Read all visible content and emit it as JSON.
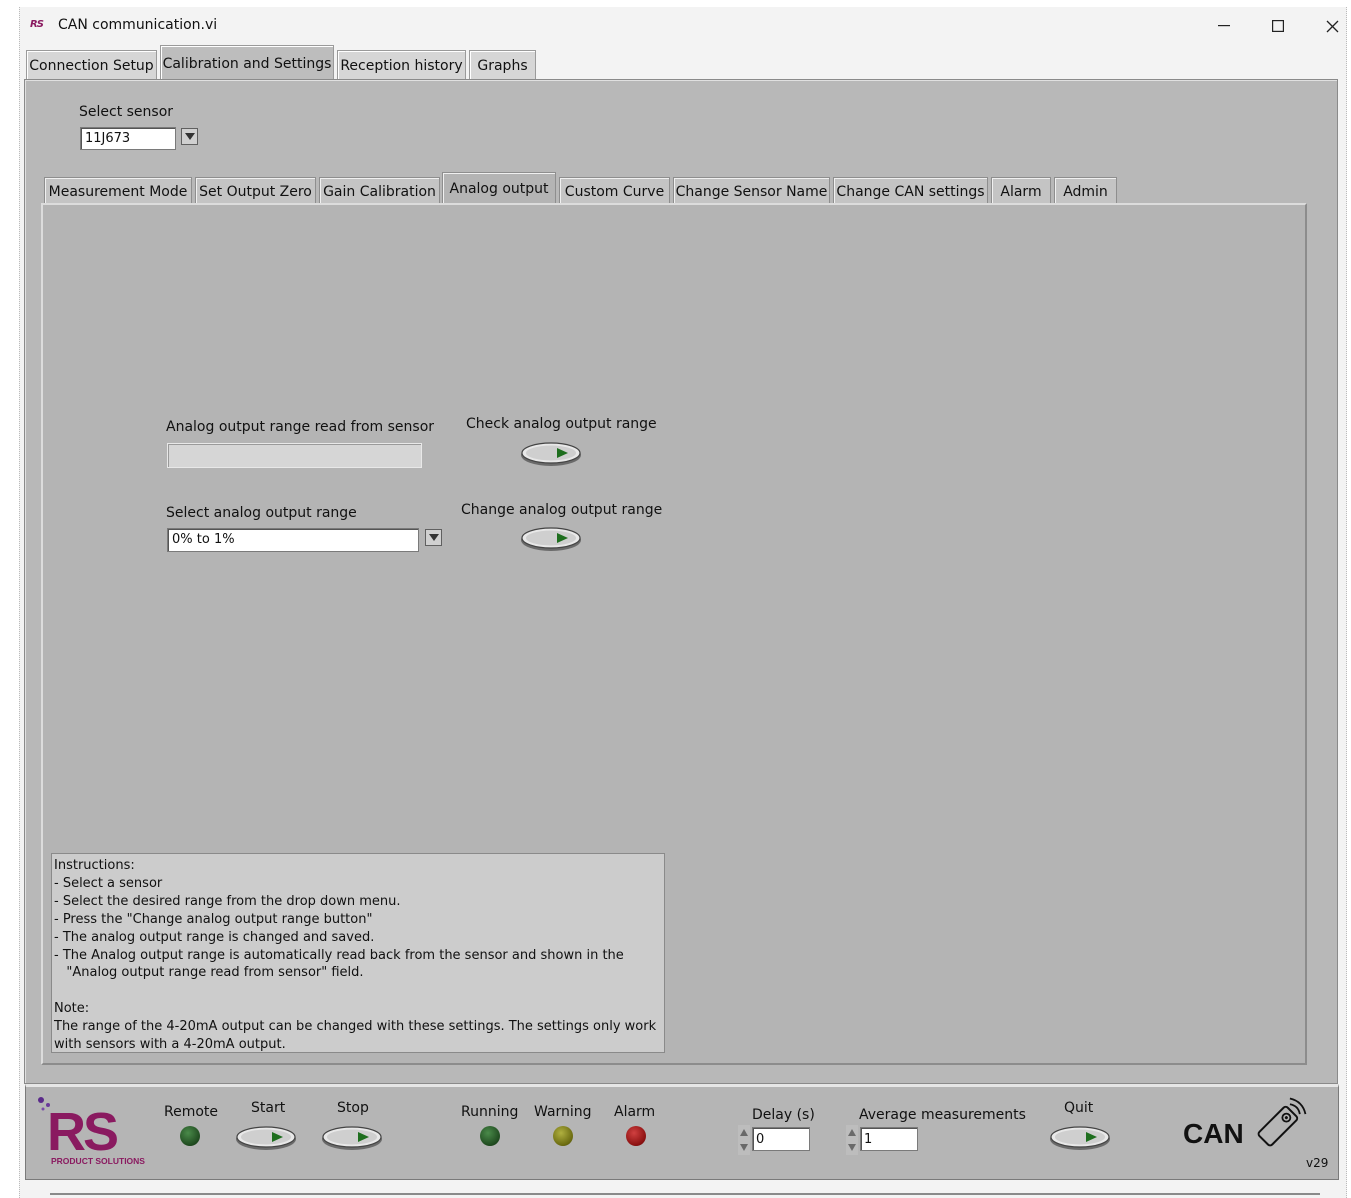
{
  "window": {
    "title": "CAN communication.vi",
    "logo_text": "RS",
    "minimize": "—",
    "maximize": "☐",
    "close": "✕"
  },
  "main_tabs": [
    {
      "label": "Connection Setup",
      "active": false
    },
    {
      "label": "Calibration and Settings",
      "active": true
    },
    {
      "label": "Reception history",
      "active": false
    },
    {
      "label": "Graphs",
      "active": false
    }
  ],
  "sensor": {
    "label": "Select sensor",
    "value": "11J673"
  },
  "sub_tabs": [
    {
      "label": "Measurement Mode",
      "active": false
    },
    {
      "label": "Set Output Zero",
      "active": false
    },
    {
      "label": "Gain Calibration",
      "active": false
    },
    {
      "label": "Analog output",
      "active": true
    },
    {
      "label": "Custom Curve",
      "active": false
    },
    {
      "label": "Change Sensor Name",
      "active": false
    },
    {
      "label": "Change CAN settings",
      "active": false
    },
    {
      "label": "Alarm",
      "active": false
    },
    {
      "label": "Admin",
      "active": false
    }
  ],
  "analog": {
    "read_label": "Analog output range read from sensor",
    "read_value": "",
    "check_label": "Check analog output range",
    "select_label": "Select analog output range",
    "select_value": "0% to 1%",
    "change_label": "Change analog output range"
  },
  "instructions": {
    "text": "Instructions:\n- Select a sensor\n- Select the desired range from the drop down menu.\n- Press the \"Change analog output range button\"\n- The analog output range is changed and saved.\n- The Analog output range is automatically read back from the sensor and shown in the\n   \"Analog output range read from sensor\" field.\n\nNote:\nThe range of the 4-20mA output can be changed with these settings. The settings only work\nwith sensors with a 4-20mA output."
  },
  "bottom": {
    "logo_main": "RS",
    "logo_sub": "PRODUCT SOLUTIONS",
    "remote_label": "Remote",
    "start_label": "Start",
    "stop_label": "Stop",
    "running_label": "Running",
    "warning_label": "Warning",
    "alarm_label": "Alarm",
    "delay_label": "Delay (s)",
    "delay_value": "0",
    "avg_label": "Average measurements",
    "avg_value": "1",
    "quit_label": "Quit",
    "can_text": "CAN",
    "version": "v29"
  },
  "colors": {
    "led_green": "#1f5a1f",
    "led_yellow": "#7a7a10",
    "led_red": "#9a1010",
    "button_arrow": "#1e6e1e",
    "logo_magenta": "#8a1a60"
  }
}
